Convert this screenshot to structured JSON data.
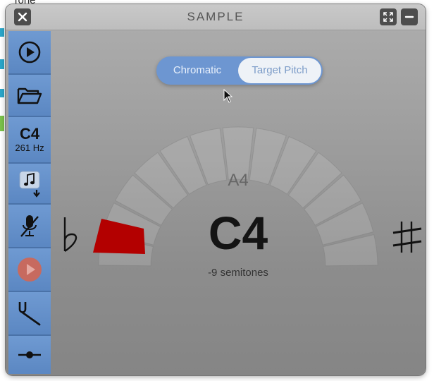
{
  "background": {
    "partial_text": "Tone"
  },
  "window": {
    "title": "SAMPLE"
  },
  "toolbar": {
    "pitch_note": "C4",
    "pitch_hz": "261 Hz"
  },
  "mode_toggle": {
    "options": [
      "Chromatic",
      "Target Pitch"
    ],
    "selected": "Target Pitch"
  },
  "tuner": {
    "target_note": "A4",
    "detected_note": "C4",
    "offset_text": "-9 semitones",
    "needle_color": "#b30000"
  },
  "colors": {
    "toolbar_blue": "#6a95cf",
    "toggle_blue": "#6d96d1",
    "record_disabled": "#c76a5f"
  }
}
